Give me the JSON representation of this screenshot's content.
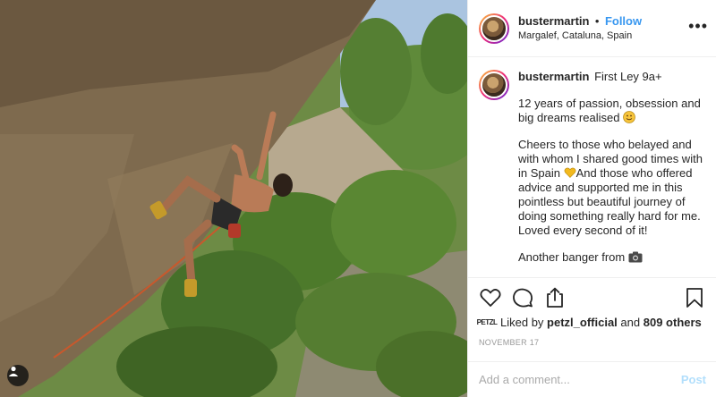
{
  "post": {
    "username": "bustermartin",
    "separator": "•",
    "follow_label": "Follow",
    "location": "Margalef, Cataluna, Spain",
    "more_label": "•••",
    "caption": {
      "username": "bustermartin",
      "title": "First Ley 9a+",
      "paragraph1": "12 years of passion, obsession and big dreams realised",
      "paragraph2a": "Cheers to those who belayed and with whom I shared good times with in Spain",
      "paragraph2b": "And those who offered advice and supported me in this pointless but beautiful journey of doing something really hard for me. Loved every second of it!",
      "paragraph3": "Another banger from"
    },
    "likes": {
      "logo_text": "PETZL",
      "prefix": "Liked by",
      "liker": "petzl_official",
      "conjunction": "and",
      "others": "809 others"
    },
    "date": "NOVEMBER 17",
    "comment": {
      "placeholder": "Add a comment...",
      "post_label": "Post"
    }
  },
  "icons": {
    "like": "heart-icon",
    "comment": "comment-icon",
    "share": "share-icon",
    "save": "bookmark-icon",
    "user_tag": "user-tag-icon",
    "camera": "camera-icon",
    "emoji_smile": "smile-emoji",
    "emoji_heart": "yellow-heart-emoji"
  },
  "colors": {
    "follow": "#3897f0",
    "post_disabled": "#b2dffc",
    "border": "#efefef",
    "text": "#262626",
    "muted": "#999999"
  }
}
